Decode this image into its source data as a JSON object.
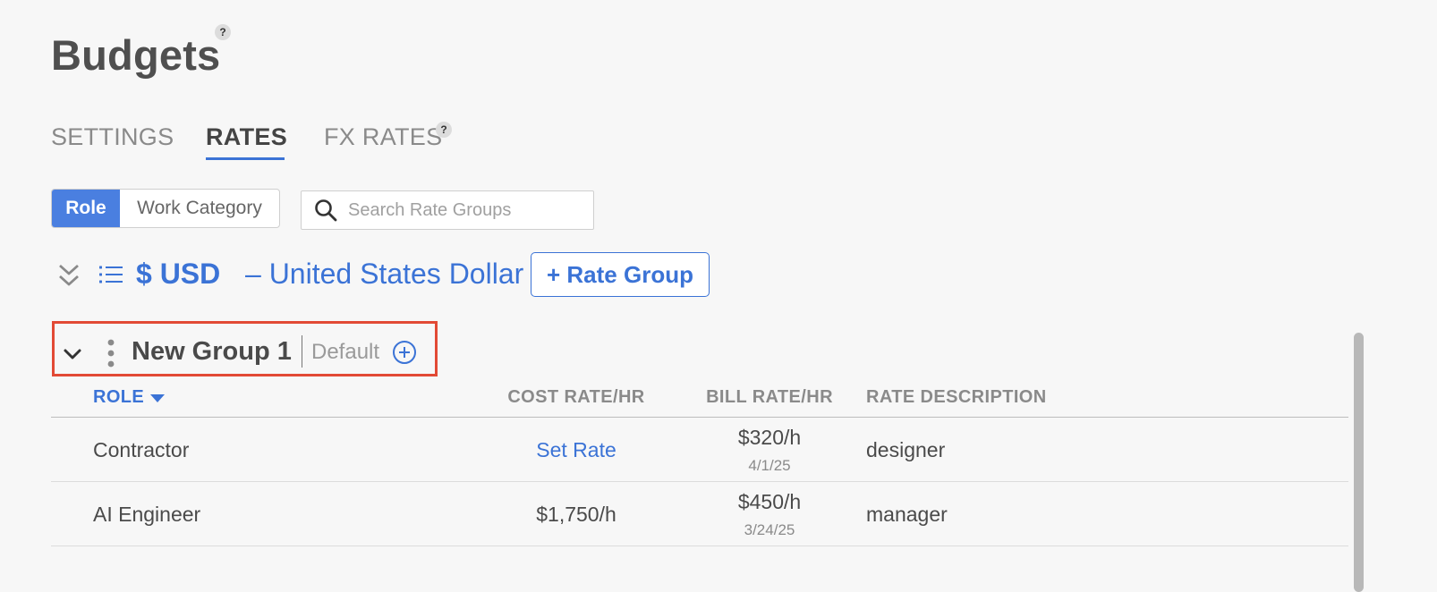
{
  "page": {
    "title": "Budgets",
    "help_glyph": "?"
  },
  "tabs": [
    {
      "label": "SETTINGS",
      "active": false
    },
    {
      "label": "RATES",
      "active": true
    },
    {
      "label": "FX RATES",
      "active": false,
      "help_glyph": "?"
    }
  ],
  "toggle": {
    "options": [
      "Role",
      "Work Category"
    ],
    "selected": "Role"
  },
  "search": {
    "placeholder": "Search Rate Groups",
    "value": ""
  },
  "currency": {
    "code": "$ USD",
    "name": "– United States Dollar",
    "add_button": "+ Rate Group"
  },
  "group": {
    "name": "New Group 1",
    "tag": "Default"
  },
  "table": {
    "columns": [
      "ROLE",
      "COST RATE/HR",
      "BILL RATE/HR",
      "RATE DESCRIPTION"
    ],
    "sorted_column": "ROLE",
    "rows": [
      {
        "role": "Contractor",
        "cost_rate": "Set Rate",
        "cost_is_link": true,
        "bill_rate": "$320/h",
        "bill_date": "4/1/25",
        "description": "designer"
      },
      {
        "role": "AI Engineer",
        "cost_rate": "$1,750/h",
        "cost_is_link": false,
        "bill_rate": "$450/h",
        "bill_date": "3/24/25",
        "description": "manager"
      }
    ]
  },
  "colors": {
    "accent": "#3b73d6",
    "toggle_active": "#4a7fe0",
    "highlight_border": "#e24a35"
  },
  "icons": [
    "help-icon",
    "search-icon",
    "collapse-all-icon",
    "list-icon",
    "chevron-down-icon",
    "drag-handle-icon",
    "add-circle-icon",
    "sort-desc-icon"
  ]
}
